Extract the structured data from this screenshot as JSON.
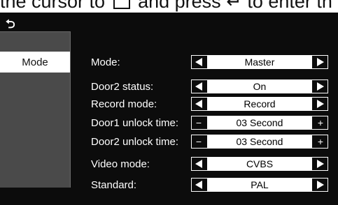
{
  "caption": {
    "text_before": "the cursor to",
    "text_after": "and press",
    "text_end": "to enter th"
  },
  "header": {
    "back_icon": "return-icon"
  },
  "sidebar": {
    "items": [
      {
        "label": "Mode",
        "selected": true
      }
    ]
  },
  "settings": [
    {
      "label": "Mode:",
      "value": "Master",
      "control": "arrows"
    },
    {
      "label": "Door2 status:",
      "value": "On",
      "control": "arrows"
    },
    {
      "label": "Record mode:",
      "value": "Record",
      "control": "arrows"
    },
    {
      "label": "Door1 unlock time:",
      "value": "03 Second",
      "control": "stepper"
    },
    {
      "label": "Door2 unlock time:",
      "value": "03 Second",
      "control": "stepper"
    },
    {
      "label": "Video mode:",
      "value": "CVBS",
      "control": "arrows"
    },
    {
      "label": "Standard:",
      "value": "PAL",
      "control": "arrows"
    }
  ],
  "controls": {
    "minus": "−",
    "plus": "+"
  },
  "colors": {
    "background": "#0c0c0c",
    "sidebar": "#4a4a4a",
    "text": "#ffffff"
  }
}
